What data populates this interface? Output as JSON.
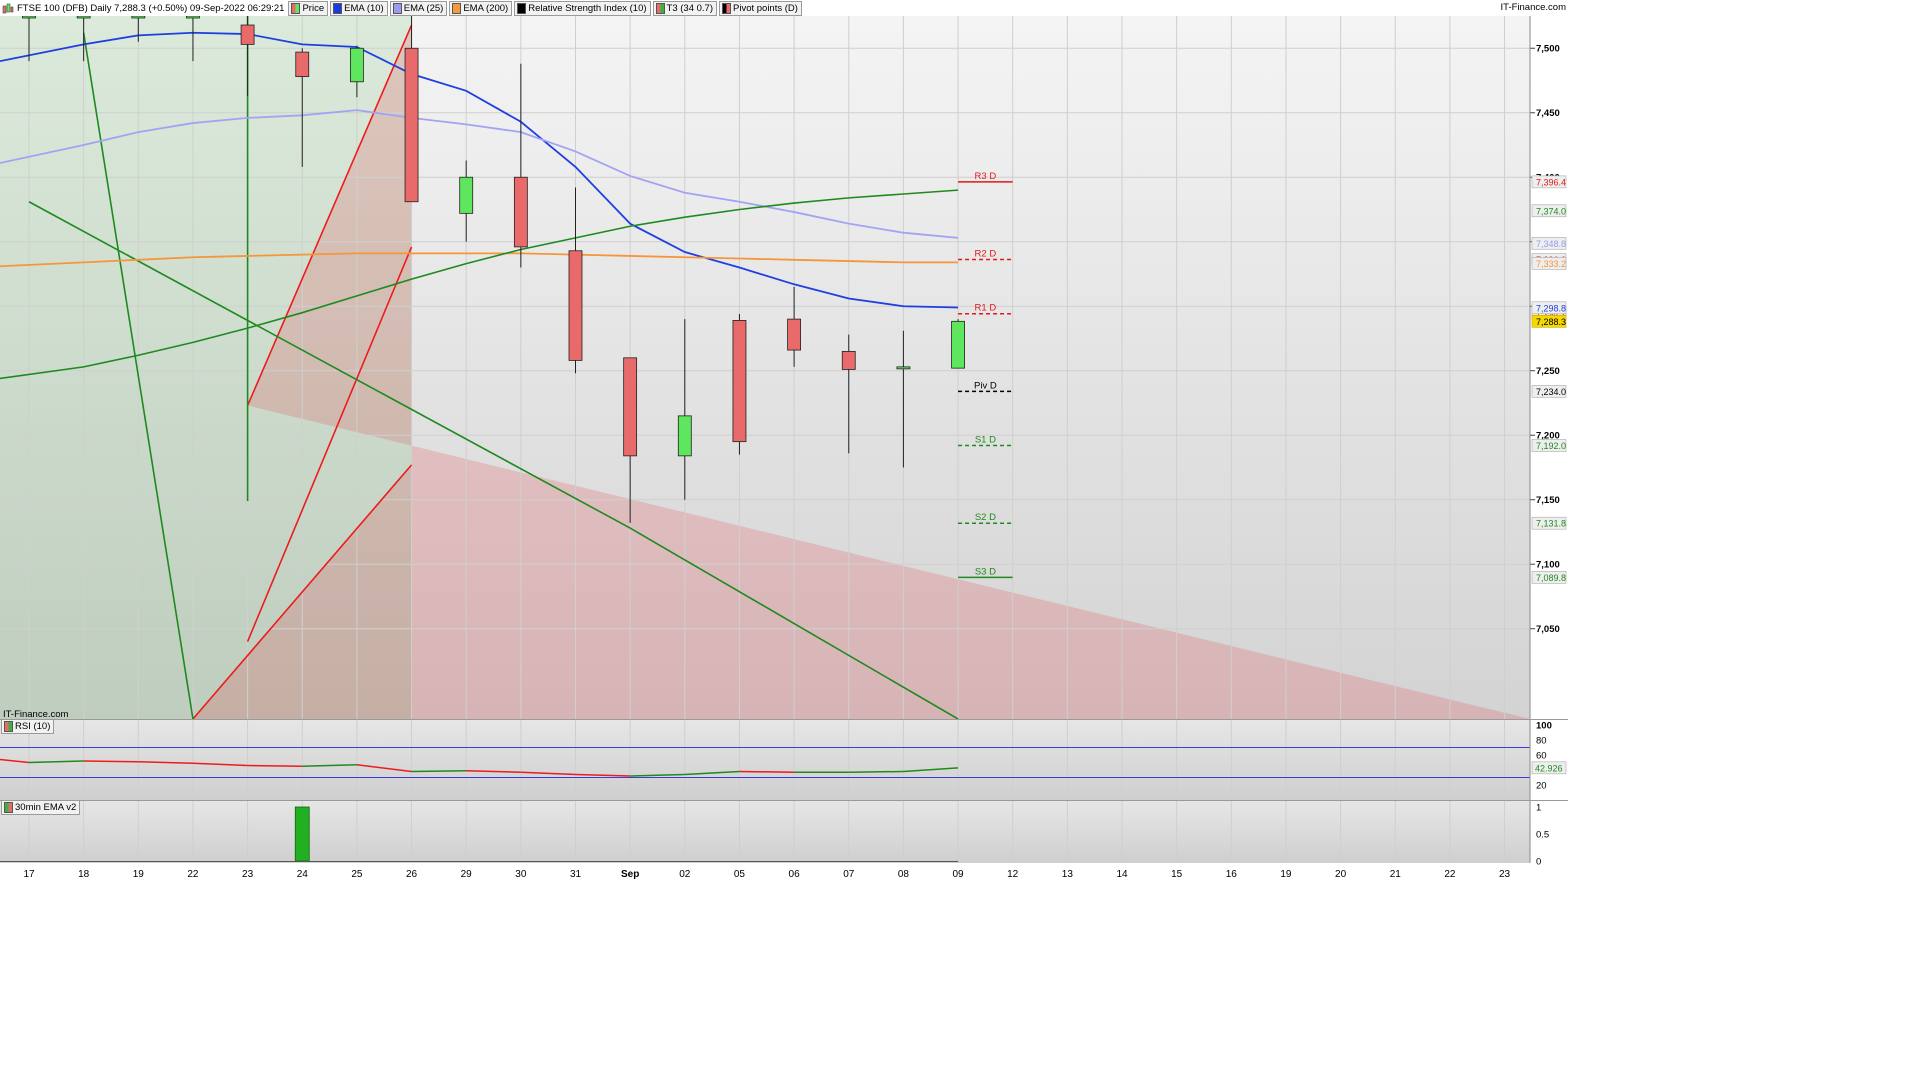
{
  "header": {
    "title": "FTSE 100 (DFB) Daily 7,288.3 (+0.50%) 09-Sep-2022 06:29:21",
    "brand": "IT-Finance.com",
    "legend": [
      {
        "label": "Price",
        "color": "#3cb043",
        "icon": "candle-icon"
      },
      {
        "label": "EMA (10)",
        "color": "#1a3be0"
      },
      {
        "label": "EMA (25)",
        "color": "#9a9af0"
      },
      {
        "label": "EMA (200)",
        "color": "#f59a3c"
      },
      {
        "label": "Relative Strength Index (10)",
        "color": "#000000"
      },
      {
        "label": "T3 (34 0.7)",
        "color": "#3cb043",
        "icon": "candle-icon"
      },
      {
        "label": "Pivot points (D)",
        "color": "#000000",
        "icon": "candle-icon"
      }
    ]
  },
  "watermark": "IT-Finance.com",
  "colors": {
    "up": "#5ee65e",
    "down": "#e86a6a",
    "ema10": "#1f3fe0",
    "ema25": "#a3a3f2",
    "ema200": "#f5963a",
    "channel_red": "#ec1c1c",
    "channel_green": "#1e8a1e",
    "last_price_bg": "#f5d800",
    "rsi_up": "#1e8a1e",
    "rsi_down": "#ec1c1c"
  },
  "chart_data": [
    {
      "type": "candlestick",
      "title": "FTSE 100 (DFB) Daily",
      "x_tick_labels": [
        "17",
        "18",
        "19",
        "22",
        "23",
        "24",
        "25",
        "26",
        "29",
        "30",
        "31",
        "Sep",
        "02",
        "05",
        "06",
        "07",
        "08",
        "09",
        "12",
        "13",
        "14",
        "15",
        "16",
        "19",
        "20",
        "21",
        "22",
        "23"
      ],
      "ylim": [
        6980,
        7525
      ],
      "y_ticks": [
        7050,
        7100,
        7150,
        7200,
        7250,
        7300,
        7350,
        7400,
        7450,
        7500
      ],
      "y_tick_labels": [
        "7,050",
        "7,100",
        "7,150",
        "7,200",
        "7,250",
        "7,300",
        "7,350",
        "7,400",
        "7,450",
        "7,500"
      ],
      "candles": [
        {
          "x": "17",
          "open": 7525,
          "high": 7525,
          "close": 7525,
          "low": 7490
        },
        {
          "x": "18",
          "open": 7525,
          "high": 7525,
          "close": 7525,
          "low": 7490
        },
        {
          "x": "19",
          "open": 7525,
          "high": 7525,
          "close": 7525,
          "low": 7505
        },
        {
          "x": "22",
          "open": 7525,
          "high": 7525,
          "close": 7525,
          "low": 7490
        },
        {
          "x": "23",
          "open": 7518,
          "high": 7525,
          "close": 7503,
          "low": 7463
        },
        {
          "x": "24",
          "open": 7497,
          "high": 7500,
          "close": 7478,
          "low": 7408
        },
        {
          "x": "25",
          "open": 7474,
          "high": 7502,
          "close": 7500,
          "low": 7462
        },
        {
          "x": "26",
          "open": 7500,
          "high": 7525,
          "close": 7381,
          "low": 7381
        },
        {
          "x": "29",
          "open": 7372,
          "high": 7413,
          "close": 7400,
          "low": 7350
        },
        {
          "x": "30",
          "open": 7400,
          "high": 7488,
          "close": 7346,
          "low": 7330
        },
        {
          "x": "31",
          "open": 7343,
          "high": 7392,
          "close": 7258,
          "low": 7248
        },
        {
          "x": "Sep",
          "open": 7260,
          "high": 7260,
          "close": 7184,
          "low": 7132
        },
        {
          "x": "02",
          "open": 7184,
          "high": 7290,
          "close": 7215,
          "low": 7150
        },
        {
          "x": "05",
          "open": 7289,
          "high": 7294,
          "close": 7195,
          "low": 7185
        },
        {
          "x": "06",
          "open": 7290,
          "high": 7315,
          "close": 7266,
          "low": 7253
        },
        {
          "x": "07",
          "open": 7265,
          "high": 7278,
          "close": 7251,
          "low": 7186
        },
        {
          "x": "08",
          "open": 7252,
          "high": 7281,
          "close": 7253,
          "low": 7175
        },
        {
          "x": "09",
          "open": 7252,
          "high": 7290,
          "close": 7288.3,
          "low": 7252
        }
      ],
      "series": [
        {
          "name": "EMA (10)",
          "values": [
            7490,
            7503,
            7510,
            7512,
            7511,
            7503,
            7501,
            7480,
            7467,
            7443,
            7408,
            7364,
            7342,
            7330,
            7317,
            7306,
            7300,
            7299
          ]
        },
        {
          "name": "EMA (25)",
          "values": [
            7411,
            7425,
            7435,
            7442,
            7446,
            7448,
            7452,
            7446,
            7441,
            7435,
            7420,
            7401,
            7388,
            7381,
            7373,
            7364,
            7357,
            7353
          ]
        },
        {
          "name": "EMA (200)",
          "values": [
            7331,
            7334,
            7336,
            7338,
            7339,
            7340,
            7341,
            7341,
            7341,
            7341,
            7340,
            7339,
            7338,
            7337,
            7336,
            7335,
            7334,
            7334
          ]
        },
        {
          "name": "T3 (34 0.7)",
          "values": [
            7244,
            7253,
            7262,
            7272,
            7283,
            7295,
            7308,
            7321,
            7333,
            7344,
            7353,
            7362,
            7369,
            7375,
            7380,
            7384,
            7387,
            7390
          ]
        }
      ],
      "pivots": [
        {
          "label": "R3 D",
          "value": 7396.4,
          "axis_label": "7,396.4",
          "color": "#e01818"
        },
        {
          "label": "R2 D",
          "value": 7336.2,
          "axis_label": "7,336.2",
          "color": "#e01818"
        },
        {
          "label": "R1 D",
          "value": 7294.2,
          "axis_label": "7,294.2",
          "color": "#e01818"
        },
        {
          "label": "Piv D",
          "value": 7234.0,
          "axis_label": "7,234.0",
          "color": "#000000"
        },
        {
          "label": "S1 D",
          "value": 7192.0,
          "axis_label": "7,192.0",
          "color": "#1e8a1e"
        },
        {
          "label": "S2 D",
          "value": 7131.8,
          "axis_label": "7,131.8",
          "color": "#1e8a1e"
        },
        {
          "label": "S3 D",
          "value": 7089.8,
          "axis_label": "7,089.8",
          "color": "#1e8a1e"
        }
      ],
      "axis_value_tags": [
        {
          "value": 7374.0,
          "label": "7,374.0",
          "color": "#1e8a1e"
        },
        {
          "value": 7348.8,
          "label": "7,348.8",
          "color": "#9a9af0"
        },
        {
          "value": 7333.2,
          "label": "7,333.2",
          "color": "#f5963a"
        },
        {
          "value": 7298.8,
          "label": "7,298.8",
          "color": "#1f3fe0"
        },
        {
          "value": 7288.3,
          "label": "7,288.3",
          "color": "#000000",
          "highlight": true
        }
      ],
      "channels": [
        {
          "name": "red-channel-upper",
          "color": "#ec1c1c",
          "points": [
            [
              "26",
              7518
            ],
            [
              "23",
              7223
            ]
          ]
        },
        {
          "name": "red-channel-middle",
          "color": "#ec1c1c",
          "points": [
            [
              "26",
              7346
            ],
            [
              "23",
              7040
            ]
          ]
        },
        {
          "name": "red-channel-lower",
          "color": "#ec1c1c",
          "points": [
            [
              "26",
              7177
            ],
            [
              "22",
              6980
            ]
          ]
        },
        {
          "name": "green-channel-upper",
          "color": "#1e8a1e",
          "points": [
            [
              "23",
              7560
            ],
            [
              "23",
              7149
            ]
          ]
        },
        {
          "name": "green-channel-middle",
          "color": "#1e8a1e",
          "points": [
            [
              "18",
              7512
            ],
            [
              "22",
              6980
            ]
          ]
        },
        {
          "name": "green-channel-lower",
          "color": "#1e8a1e",
          "points": [
            [
              "17",
              7381
            ],
            [
              "Sep",
              7128
            ],
            [
              "09",
              6980
            ]
          ]
        }
      ]
    },
    {
      "type": "line",
      "title": "RSI (10)",
      "ylim": [
        0,
        100
      ],
      "y_tick_labels": [
        "100",
        "80",
        "60",
        "40",
        "20"
      ],
      "levels": [
        70,
        30
      ],
      "last_value_label": "42.926",
      "values": [
        54,
        50,
        52,
        51,
        49,
        46,
        45,
        47,
        38,
        39,
        37,
        34,
        32,
        34,
        38,
        37,
        37,
        38,
        42.9
      ]
    },
    {
      "type": "bar",
      "title": "30min EMA v2",
      "ylim": [
        0,
        1
      ],
      "y_tick_labels": [
        "1",
        "0.5",
        "0"
      ],
      "bars": [
        {
          "x": "24",
          "value": 1
        }
      ]
    }
  ]
}
